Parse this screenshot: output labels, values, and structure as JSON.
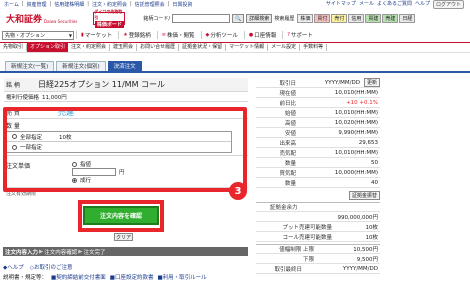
{
  "top": {
    "links": [
      "ホーム",
      "資産管理",
      "信用建株明細",
      "注文・約定照会",
      "信託管理照会",
      "日興投資"
    ],
    "right_links": [
      "サイトマップ",
      "メール",
      "よくあるご質問",
      "ヘルプ"
    ],
    "logout": "ログアウト"
  },
  "brand": {
    "logo": "大和証券",
    "logo_sub": "Daiwa Securities",
    "board_line1": "ダイワの先物取引",
    "board_line2": "株価ボード"
  },
  "search": {
    "label": "銘柄コード/",
    "placeholder": "",
    "go": "🔍",
    "detail": "詳細検索",
    "history": "検索履歴"
  },
  "quick": [
    "株価",
    "買付",
    "売付",
    "信用",
    "買建",
    "売建",
    "日経"
  ],
  "nav": {
    "account_select": "先物・オプション",
    "items": [
      "マーケット",
      "登録銘柄",
      "株価・閲覧",
      "分析ツール",
      "口座情報",
      "サポート"
    ]
  },
  "subnav": [
    "先物取引",
    "オプション取引",
    "注文・約定照会",
    "建玉照会",
    "お問い合せ履歴",
    "証拠金状況・保留",
    "マーケット情報",
    "メール設定",
    "手数料等"
  ],
  "tabs": [
    "新規注文(一覧)",
    "新規注文(個別)",
    "決済注文"
  ],
  "order": {
    "instrument_label": "銘 柄",
    "instrument": "日経225オプション 11/MM コール",
    "lot_label": "権利行使価格",
    "lot_value": "11,000円",
    "side_label": "売 買",
    "side_value": "売建",
    "qty_label": "数 量",
    "qty_options": [
      {
        "label": "全部指定",
        "value": "10枚"
      },
      {
        "label": "一部指定",
        "value": ""
      }
    ],
    "price_label": "注文単価",
    "price_options": [
      "指値",
      "成行"
    ],
    "price_unit": "円",
    "expiry_label": "注文有効期限"
  },
  "buttons": {
    "confirm": "注文内容を確認",
    "clear": "クリア"
  },
  "flow": [
    "注文内容入力",
    "注文内容確認",
    "注文完了"
  ],
  "help": [
    "ヘルプ",
    "お取引のご注意"
  ],
  "explain": {
    "label": "説明書・規定等：",
    "items": [
      "契約締結前交付書面",
      "口座設定約款書",
      "利用・取引ルール"
    ]
  },
  "step_badge": "3",
  "quote": {
    "rows1": [
      {
        "label": "取引日",
        "value": "YYYY/MM/DD"
      },
      {
        "label": "現在値",
        "value": "10,010(HH:MM)"
      },
      {
        "label": "前日比",
        "value": "+10   +0.1%"
      },
      {
        "label": "始値",
        "value": "10,010(HH:MM)"
      },
      {
        "label": "高値",
        "value": "10,020(HH:MM)"
      },
      {
        "label": "安値",
        "value": "9,990(HH:MM)"
      },
      {
        "label": "出来高",
        "value": "29,653"
      },
      {
        "label": "売気配",
        "value": "10,010(HH:MM)"
      },
      {
        "label": "数量",
        "value": "50"
      },
      {
        "label": "買気配",
        "value": "10,000(HH:MM)"
      },
      {
        "label": "数量",
        "value": "40"
      }
    ],
    "refresh": "更新",
    "margin_button": "証拠金振替",
    "rows2": [
      {
        "label": "証拠金余力",
        "value": ""
      },
      {
        "label": "",
        "value": "990,000,000円"
      },
      {
        "label": "プット売建可能数量",
        "value": "10枚"
      },
      {
        "label": "コール売建可能数量",
        "value": "10枚"
      }
    ],
    "rows3": [
      {
        "label": "値幅制限 上限",
        "value": "10,500円"
      },
      {
        "label": "下限",
        "value": "9,500円"
      },
      {
        "label": "取引最終日",
        "value": "YYYY/MM/DD"
      }
    ]
  },
  "colors": {
    "brand_red": "#c8102e",
    "tab_blue": "#2a58a8",
    "highlight_red": "#e8262b",
    "confirm_green": "#2fae2f"
  }
}
